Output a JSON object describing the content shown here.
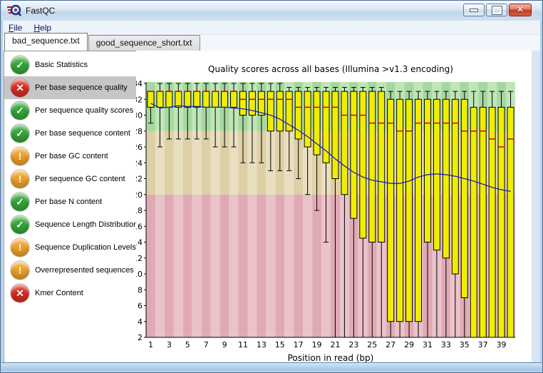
{
  "window": {
    "title": "FastQC"
  },
  "menu": {
    "items": [
      {
        "label": "File"
      },
      {
        "label": "Help"
      }
    ]
  },
  "tabs": [
    {
      "label": "bad_sequence.txt",
      "active": true
    },
    {
      "label": "good_sequence_short.txt",
      "active": false
    }
  ],
  "sidebar": {
    "status_colors": {
      "pass": "#35a83a",
      "warn": "#f0a32a",
      "fail": "#dd2c23"
    },
    "status_glyphs": {
      "pass": "✓",
      "warn": "!",
      "fail": "✕"
    },
    "items": [
      {
        "status": "pass",
        "label": "Basic Statistics",
        "selected": false
      },
      {
        "status": "fail",
        "label": "Per base sequence quality",
        "selected": true
      },
      {
        "status": "pass",
        "label": "Per sequence quality scores",
        "selected": false
      },
      {
        "status": "pass",
        "label": "Per base sequence content",
        "selected": false
      },
      {
        "status": "warn",
        "label": "Per base GC content",
        "selected": false
      },
      {
        "status": "warn",
        "label": "Per sequence GC content",
        "selected": false
      },
      {
        "status": "pass",
        "label": "Per base N content",
        "selected": false
      },
      {
        "status": "pass",
        "label": "Sequence Length Distribution",
        "selected": false
      },
      {
        "status": "warn",
        "label": "Sequence Duplication Levels",
        "selected": false
      },
      {
        "status": "warn",
        "label": "Overrepresented sequences",
        "selected": false
      },
      {
        "status": "fail",
        "label": "Kmer Content",
        "selected": false
      }
    ]
  },
  "chart_data": {
    "type": "boxplot",
    "title": "Quality scores across all bases (Illumina >v1.3 encoding)",
    "xlabel": "Position in read (bp)",
    "ylim": [
      2,
      34
    ],
    "ytick_step": 2,
    "x_tick_labels": [
      1,
      3,
      5,
      7,
      9,
      11,
      13,
      15,
      17,
      19,
      21,
      23,
      25,
      27,
      29,
      31,
      33,
      35,
      37,
      39
    ],
    "n_positions": 40,
    "bands": [
      {
        "name": "good",
        "from": 28,
        "to": 34.2,
        "color_dark": "#a7d7a0",
        "color_light": "#bfe6b7"
      },
      {
        "name": "ok",
        "from": 20,
        "to": 28,
        "color_dark": "#ddd0a5",
        "color_light": "#e8dfc0"
      },
      {
        "name": "bad",
        "from": 2,
        "to": 20,
        "color_dark": "#e0aab4",
        "color_light": "#eac3ca"
      }
    ],
    "colors": {
      "box_fill": "#f0ee00",
      "box_border": "#000000",
      "median": "#cc1111",
      "mean_line": "#2222bb",
      "whisker": "#000000"
    },
    "series": {
      "p10": [
        29,
        26,
        27,
        27,
        27,
        27,
        27,
        26,
        26,
        26,
        24,
        24,
        24,
        23,
        23,
        23,
        22,
        20,
        18,
        14,
        2,
        2,
        2,
        2,
        2,
        2,
        2,
        2,
        2,
        2,
        2,
        2,
        2,
        2,
        2,
        2,
        2,
        2,
        2,
        2
      ],
      "p25": [
        31,
        31,
        31,
        31,
        31,
        31,
        31,
        31,
        31,
        31,
        30,
        30,
        30,
        28,
        28,
        28,
        27,
        26,
        25,
        24,
        22,
        20,
        17,
        14.5,
        14,
        14,
        4,
        4,
        4,
        4,
        14,
        13,
        12,
        10,
        7,
        2,
        2,
        2,
        2,
        2
      ],
      "median": [
        33,
        33,
        33,
        33,
        33,
        33,
        33,
        33,
        33,
        33,
        32,
        32,
        32,
        32,
        32,
        32,
        31,
        31,
        31,
        31,
        31,
        30,
        30,
        30,
        29,
        29,
        29,
        28,
        28,
        29,
        29,
        29,
        29,
        29,
        28,
        28,
        28,
        27,
        26,
        27
      ],
      "p75": [
        33,
        33,
        33,
        33,
        33,
        33,
        33,
        33,
        33,
        33,
        33,
        33,
        33,
        33,
        33,
        33,
        33,
        33,
        33,
        33,
        33,
        33,
        33,
        33,
        33,
        33,
        32,
        32,
        32,
        32,
        32,
        32,
        32,
        32,
        32,
        31,
        31,
        31,
        31,
        31
      ],
      "p90": [
        33,
        34,
        34,
        34,
        34,
        34,
        34,
        34,
        34,
        34,
        34,
        34,
        34,
        34,
        34,
        33.5,
        33.5,
        33.5,
        33.5,
        33.5,
        33.5,
        33.5,
        33.5,
        33.5,
        33.5,
        33.5,
        33,
        33,
        33,
        33,
        33,
        33,
        33,
        33,
        33,
        33,
        33,
        33,
        33,
        33
      ],
      "mean": [
        31.5,
        30.9,
        31.0,
        31.2,
        31.1,
        31.1,
        31.0,
        31.0,
        31.0,
        30.9,
        30.8,
        30.6,
        30.3,
        30.0,
        29.5,
        28.8,
        28.1,
        27.3,
        26.4,
        25.5,
        24.5,
        23.6,
        22.8,
        22.2,
        21.8,
        21.6,
        21.4,
        21.4,
        21.7,
        22.2,
        22.5,
        22.6,
        22.5,
        22.3,
        22.0,
        21.7,
        21.3,
        20.9,
        20.6,
        20.4
      ]
    }
  }
}
